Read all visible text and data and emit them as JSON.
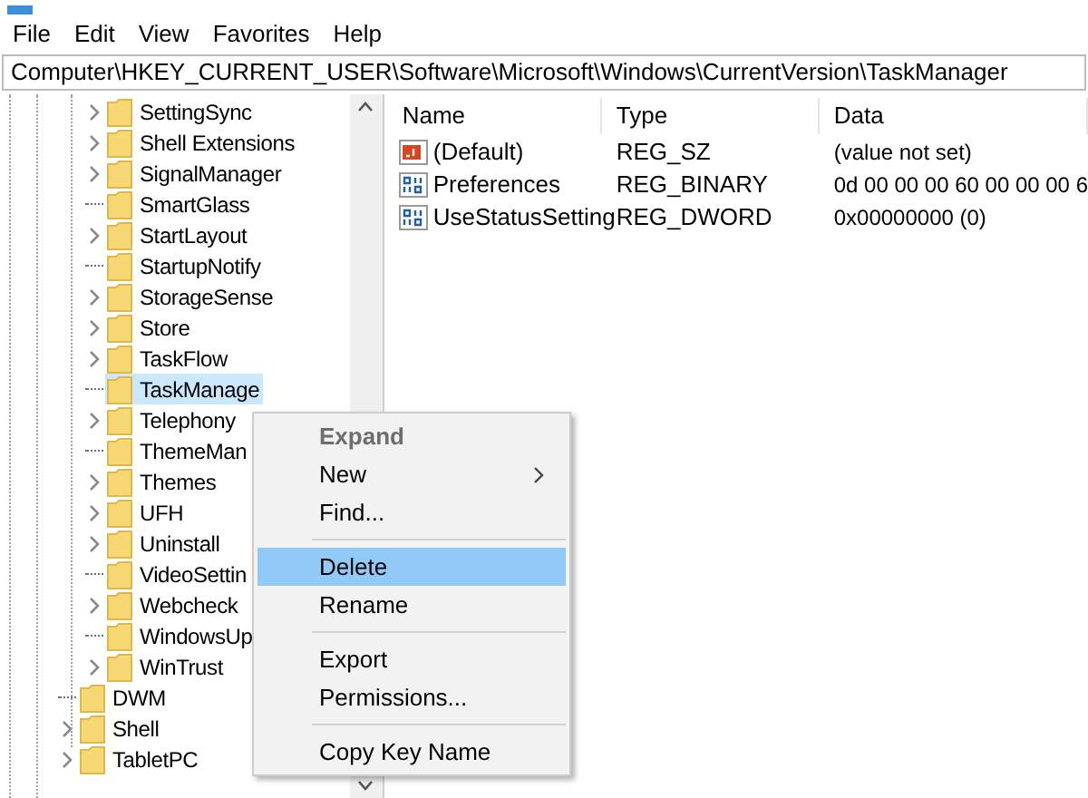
{
  "menu_bar": [
    "File",
    "Edit",
    "View",
    "Favorites",
    "Help"
  ],
  "address_bar": {
    "value": "Computer\\HKEY_CURRENT_USER\\Software\\Microsoft\\Windows\\CurrentVersion\\TaskManager"
  },
  "tree": {
    "items": [
      {
        "children": [
          {
            "label": "SettingSync",
            "expandable": true,
            "selected": false
          },
          {
            "label": "Shell Extensions",
            "expandable": true,
            "selected": false
          },
          {
            "label": "SignalManager",
            "expandable": true,
            "selected": false
          },
          {
            "label": "SmartGlass",
            "expandable": false,
            "selected": false
          },
          {
            "label": "StartLayout",
            "expandable": true,
            "selected": false
          },
          {
            "label": "StartupNotify",
            "expandable": false,
            "selected": false
          },
          {
            "label": "StorageSense",
            "expandable": true,
            "selected": false
          },
          {
            "label": "Store",
            "expandable": true,
            "selected": false
          },
          {
            "label": "TaskFlow",
            "expandable": true,
            "selected": false
          },
          {
            "label": "TaskManage",
            "expandable": false,
            "selected": true
          },
          {
            "label": "Telephony",
            "expandable": true,
            "selected": false
          },
          {
            "label": "ThemeMan",
            "expandable": false,
            "selected": false
          },
          {
            "label": "Themes",
            "expandable": true,
            "selected": false
          },
          {
            "label": "UFH",
            "expandable": true,
            "selected": false
          },
          {
            "label": "Uninstall",
            "expandable": true,
            "selected": false
          },
          {
            "label": "VideoSettin",
            "expandable": false,
            "selected": false
          },
          {
            "label": "Webcheck",
            "expandable": true,
            "selected": false
          },
          {
            "label": "WindowsUp",
            "expandable": false,
            "selected": false
          },
          {
            "label": "WinTrust",
            "expandable": true,
            "selected": false
          }
        ]
      },
      {
        "label": "DWM",
        "expandable": false,
        "selected": false
      },
      {
        "label": "Shell",
        "expandable": true,
        "selected": false
      },
      {
        "label": "TabletPC",
        "expandable": true,
        "selected": false
      }
    ]
  },
  "values": {
    "columns": [
      "Name",
      "Type",
      "Data"
    ],
    "rows": [
      {
        "kind": "string",
        "name": "(Default)",
        "type": "REG_SZ",
        "data": "(value not set)"
      },
      {
        "kind": "binary",
        "name": "Preferences",
        "type": "REG_BINARY",
        "data": "0d 00 00 00 60 00 00 00 6"
      },
      {
        "kind": "binary",
        "name": "UseStatusSetting",
        "type": "REG_DWORD",
        "data": "0x00000000 (0)"
      }
    ]
  },
  "context_menu": {
    "items": [
      {
        "kind": "item",
        "label": "Expand",
        "bold": true,
        "disabled": true,
        "submenu": false,
        "selected": false
      },
      {
        "kind": "item",
        "label": "New",
        "bold": false,
        "disabled": false,
        "submenu": true,
        "selected": false
      },
      {
        "kind": "item",
        "label": "Find...",
        "bold": false,
        "disabled": false,
        "submenu": false,
        "selected": false
      },
      {
        "kind": "separator"
      },
      {
        "kind": "item",
        "label": "Delete",
        "bold": false,
        "disabled": false,
        "submenu": false,
        "selected": true
      },
      {
        "kind": "item",
        "label": "Rename",
        "bold": false,
        "disabled": false,
        "submenu": false,
        "selected": false
      },
      {
        "kind": "separator"
      },
      {
        "kind": "item",
        "label": "Export",
        "bold": false,
        "disabled": false,
        "submenu": false,
        "selected": false
      },
      {
        "kind": "item",
        "label": "Permissions...",
        "bold": false,
        "disabled": false,
        "submenu": false,
        "selected": false
      },
      {
        "kind": "separator"
      },
      {
        "kind": "item",
        "label": "Copy Key Name",
        "bold": false,
        "disabled": false,
        "submenu": false,
        "selected": false
      }
    ]
  }
}
